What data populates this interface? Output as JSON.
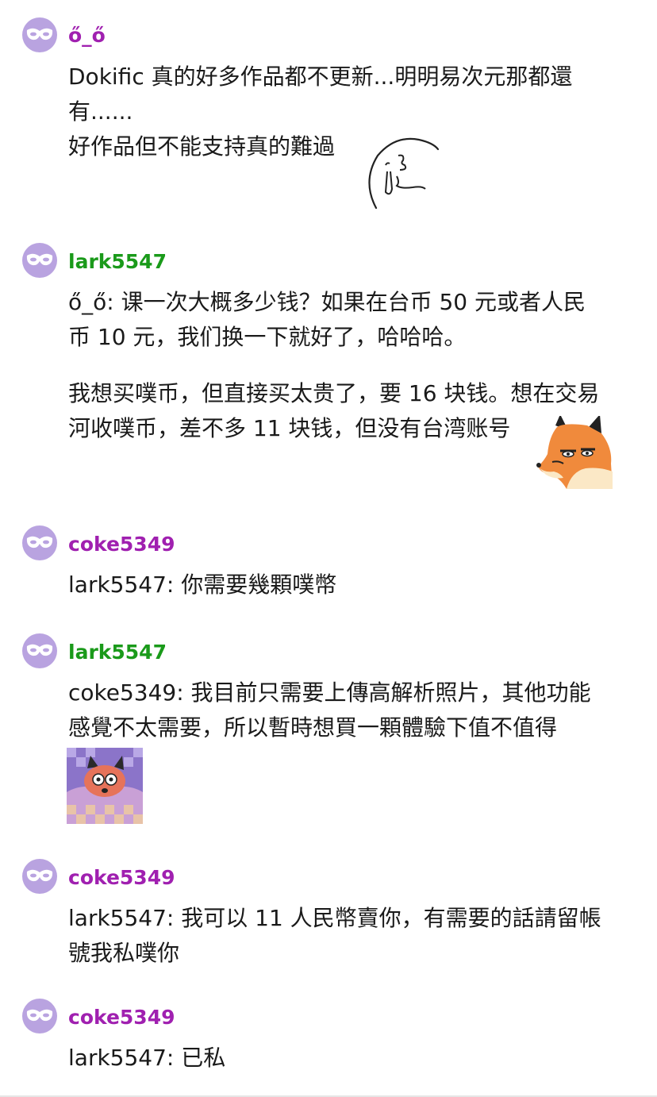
{
  "colors": {
    "purple_user": "#a020b0",
    "green_user": "#1a9a1a",
    "avatar_bg": "#b9a3e0"
  },
  "comments": [
    {
      "username": "ő_ő",
      "user_color": "purple",
      "lines": [
        "Dokific 真的好多作品都不更新...明明易次元那都還",
        "有......",
        "好作品但不能支持真的難過"
      ],
      "sticker": "crying-face-sticker"
    },
    {
      "username": "lark5547",
      "user_color": "green",
      "lines": [
        "ő_ő: 课一次大概多少钱？如果在台币 50 元或者人民",
        "币 10 元，我们换一下就好了，哈哈哈。"
      ],
      "lines2": [
        "我想买噗币，但直接买太贵了，要 16 块钱。想在交易",
        "河收噗币，差不多 11 块钱，但没有台湾账号"
      ],
      "sticker": "annoyed-fox-sticker"
    },
    {
      "username": "coke5349",
      "user_color": "purple",
      "lines": [
        "lark5547: 你需要幾顆噗幣"
      ]
    },
    {
      "username": "lark5547",
      "user_color": "green",
      "lines": [
        "coke5349: 我目前只需要上傳高解析照片，其他功能",
        "感覺不太需要，所以暫時想買一顆體驗下值不值得"
      ],
      "sticker": "fox-in-blanket-sticker"
    },
    {
      "username": "coke5349",
      "user_color": "purple",
      "lines": [
        "lark5547: 我可以 11 人民幣賣你，有需要的話請留帳",
        "號我私噗你"
      ]
    },
    {
      "username": "coke5349",
      "user_color": "purple",
      "lines": [
        "lark5547: 已私"
      ]
    }
  ]
}
